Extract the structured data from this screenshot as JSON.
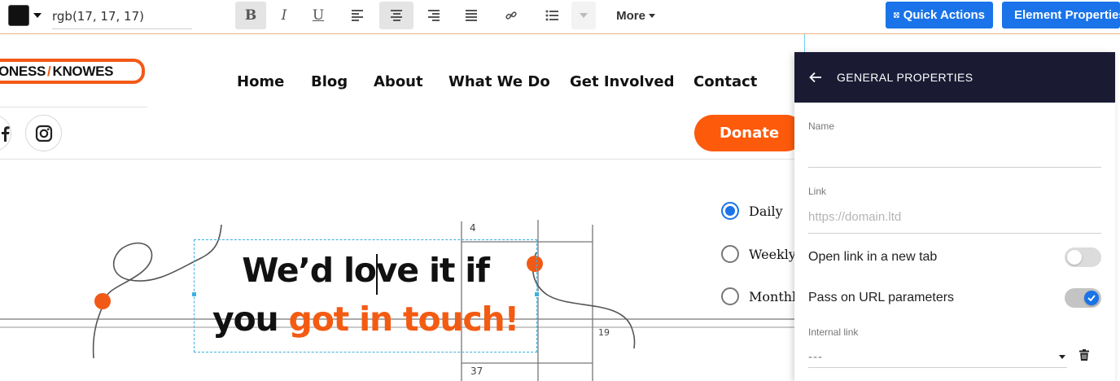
{
  "toolbar": {
    "color_value": "rgb(17, 17, 17)",
    "swatch_color": "#111111",
    "bold_label": "B",
    "italic_label": "I",
    "underline_label": "U",
    "more_label": "More",
    "icons": [
      "text-color-swatch",
      "bold",
      "italic",
      "underline",
      "align-left",
      "align-center",
      "align-right",
      "align-justify",
      "link",
      "list",
      "list-dropdown",
      "more-dropdown"
    ],
    "active_alignment": "center"
  },
  "actions": {
    "quick_actions_label": "Quick Actions",
    "element_properties_label": "Element Properties",
    "accent": "#1a73e8"
  },
  "site": {
    "logo_left": "ONESS",
    "logo_right": "KNOWES",
    "brand_color": "#f15a16",
    "nav": [
      "Home",
      "Blog",
      "About",
      "What We Do",
      "Get Involved",
      "Contact"
    ],
    "social_icons": [
      "facebook-icon",
      "instagram-icon"
    ],
    "donate_label": "Donate"
  },
  "hero": {
    "line1": "We’d love it if",
    "line2_plain": "you ",
    "line2_highlight": "got in touch!",
    "highlight_color": "#f35b12",
    "sketch_labels": [
      "4",
      "19",
      "37"
    ]
  },
  "frequency": {
    "options": [
      "Daily",
      "Weekly",
      "Monthly"
    ],
    "selected": "Daily"
  },
  "panel": {
    "title": "GENERAL PROPERTIES",
    "name_label": "Name",
    "name_value": "",
    "link_label": "Link",
    "link_placeholder": "https://domain.ltd",
    "new_tab_label": "Open link in a new tab",
    "new_tab_on": false,
    "url_params_label": "Pass on URL parameters",
    "url_params_on": true,
    "internal_link_label": "Internal link",
    "internal_link_value": "---"
  }
}
